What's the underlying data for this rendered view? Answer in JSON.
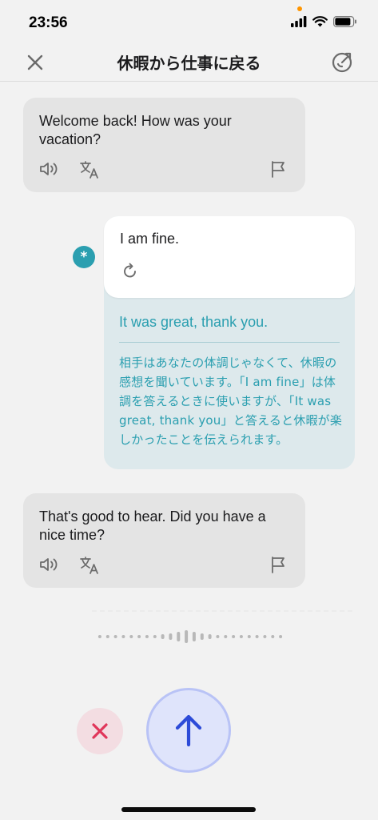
{
  "status_bar": {
    "time": "23:56"
  },
  "nav": {
    "title": "休暇から仕事に戻る"
  },
  "messages": [
    {
      "role": "ai",
      "text": "Welcome back! How was your vacation?"
    },
    {
      "role": "user",
      "text": "I am fine.",
      "correction": "It was great, thank you.",
      "explanation": "相手はあなたの体調じゃなくて、休暇の感想を聞いています。「I am fine」は体調を答えるときに使いますが、「It was great, thank you」と答えると休暇が楽しかったことを伝えられます。",
      "avatar_symbol": "*"
    },
    {
      "role": "ai",
      "text": "That's good to hear. Did you have a nice time?"
    }
  ],
  "colors": {
    "accent": "#2b9fb0",
    "send": "#2d4bd8",
    "cancel": "#e0365a"
  },
  "icons": [
    "close-icon",
    "goal-icon",
    "speaker-icon",
    "translate-icon",
    "flag-icon",
    "retry-icon",
    "cancel-icon",
    "arrow-up-icon"
  ]
}
